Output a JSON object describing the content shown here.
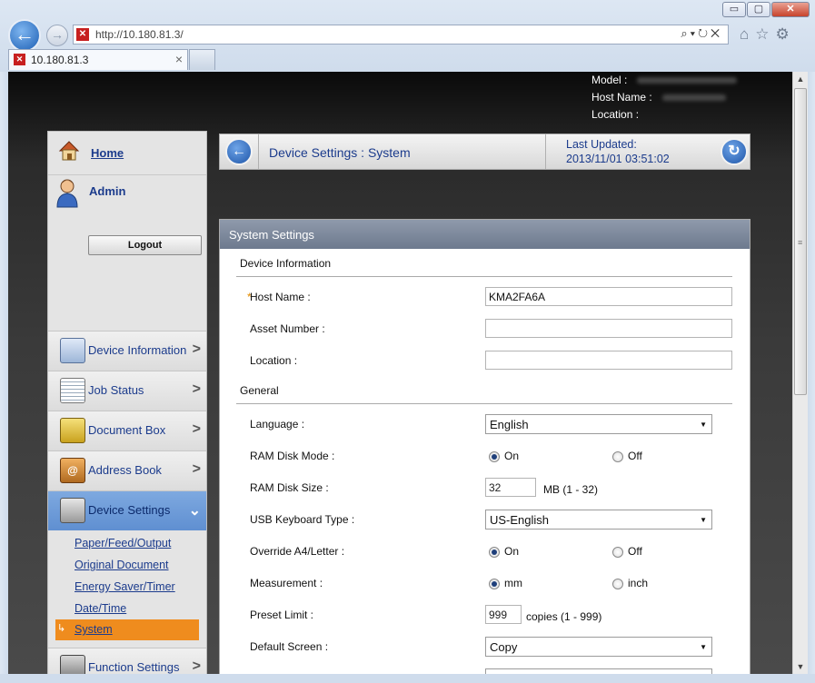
{
  "browser": {
    "url": "http://10.180.81.3/",
    "tab_title": "10.180.81.3",
    "window_buttons": {
      "minimize": "▭",
      "maximize": "▢",
      "close": "✕"
    }
  },
  "device_info": {
    "model_label": "Model :",
    "host_label": "Host Name :",
    "location_label": "Location :"
  },
  "sidebar": {
    "home": "Home",
    "user": "Admin",
    "logout": "Logout",
    "nav": [
      {
        "label": "Device Information",
        "icon": "device-info-icon"
      },
      {
        "label": "Job Status",
        "icon": "job-status-icon"
      },
      {
        "label": "Document Box",
        "icon": "document-box-icon"
      },
      {
        "label": "Address Book",
        "icon": "address-book-icon"
      },
      {
        "label": "Device Settings",
        "icon": "device-settings-icon"
      },
      {
        "label": "Function Settings",
        "icon": "function-settings-icon"
      }
    ],
    "sub_items": [
      "Paper/Feed/Output",
      "Original Document",
      "Energy Saver/Timer",
      "Date/Time",
      "System"
    ]
  },
  "header": {
    "breadcrumb": "Device Settings : System",
    "last_updated_label": "Last Updated:",
    "last_updated_value": "2013/11/01 03:51:02"
  },
  "content": {
    "title": "System Settings",
    "sections": {
      "device_info": "Device Information",
      "general": "General"
    },
    "fields": {
      "host_name": {
        "required": "*",
        "label": "Host Name :",
        "value": "KMA2FA6A"
      },
      "asset_number": {
        "label": "Asset Number :",
        "value": ""
      },
      "location": {
        "label": "Location :",
        "value": ""
      },
      "language": {
        "label": "Language :",
        "value": "English"
      },
      "ram_disk_mode": {
        "label": "RAM Disk Mode :",
        "on": "On",
        "off": "Off"
      },
      "ram_disk_size": {
        "label": "RAM Disk Size :",
        "value": "32",
        "unit": "MB (1 - 32)"
      },
      "usb_keyboard": {
        "label": "USB Keyboard Type :",
        "value": "US-English"
      },
      "override_a4": {
        "label": "Override A4/Letter :",
        "on": "On",
        "off": "Off"
      },
      "measurement": {
        "label": "Measurement :",
        "mm": "mm",
        "inch": "inch"
      },
      "preset_limit": {
        "label": "Preset Limit :",
        "value": "999",
        "unit": "copies (1 - 999)"
      },
      "default_screen": {
        "label": "Default Screen :",
        "value": "Copy"
      }
    }
  }
}
